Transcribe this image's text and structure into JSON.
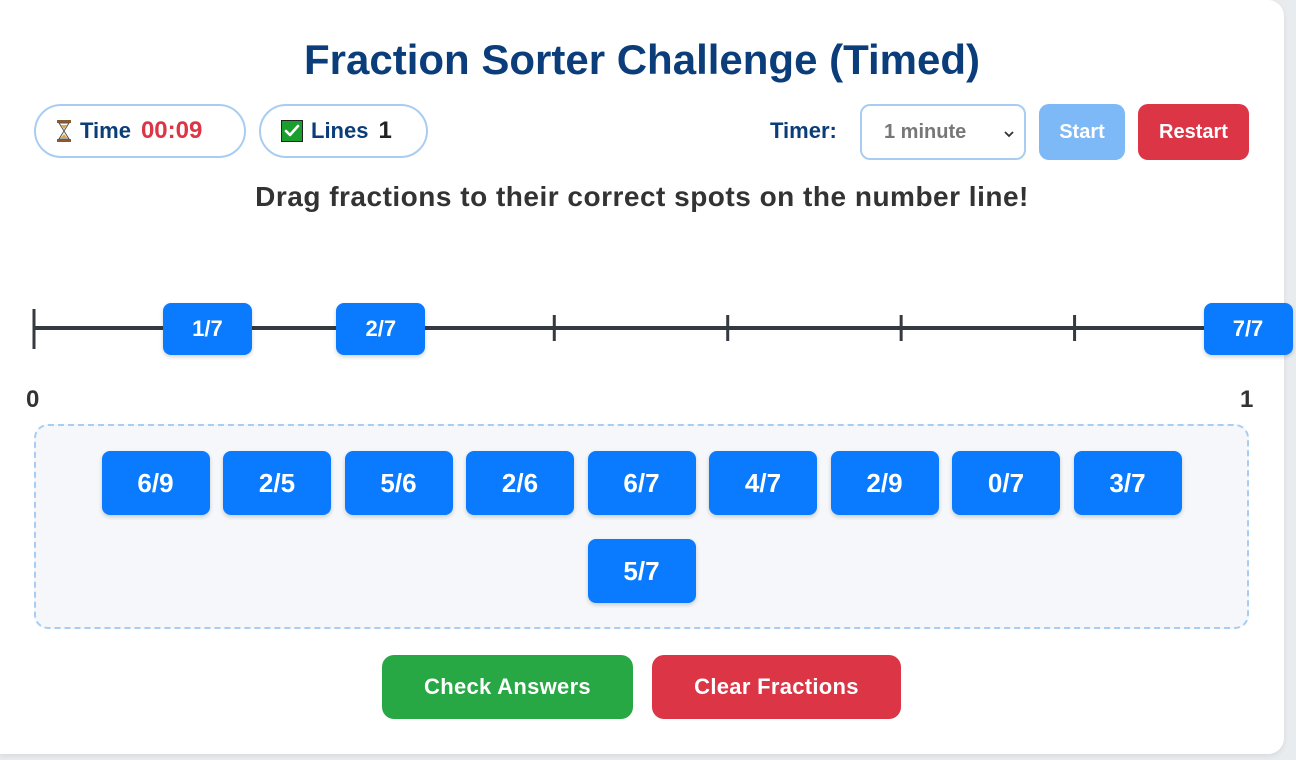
{
  "title": "Fraction Sorter Challenge (Timed)",
  "stats": {
    "time_label": "Time",
    "time_value": "00:09",
    "time_icon": "hourglass-icon",
    "lines_label": "Lines",
    "lines_value": "1",
    "lines_icon": "check-box-icon"
  },
  "timer": {
    "label": "Timer:",
    "selected": "1 minute",
    "start_label": "Start",
    "restart_label": "Restart"
  },
  "instructions": "Drag fractions to their correct spots on the number line!",
  "number_line": {
    "start_label": "0",
    "end_label": "1",
    "divisions": 7,
    "placed": [
      {
        "label": "1/7",
        "value": 1
      },
      {
        "label": "2/7",
        "value": 2
      },
      {
        "label": "7/7",
        "value": 7
      }
    ]
  },
  "bank": {
    "tiles": [
      "6/9",
      "2/5",
      "5/6",
      "2/6",
      "6/7",
      "4/7",
      "2/9",
      "0/7",
      "3/7",
      "5/7"
    ]
  },
  "actions": {
    "check_label": "Check Answers",
    "clear_label": "Clear Fractions"
  },
  "colors": {
    "title": "#0a3d7a",
    "tile": "#0a7bff",
    "check": "#28a745",
    "danger": "#dc3545",
    "start_disabled": "#7db8f7"
  }
}
